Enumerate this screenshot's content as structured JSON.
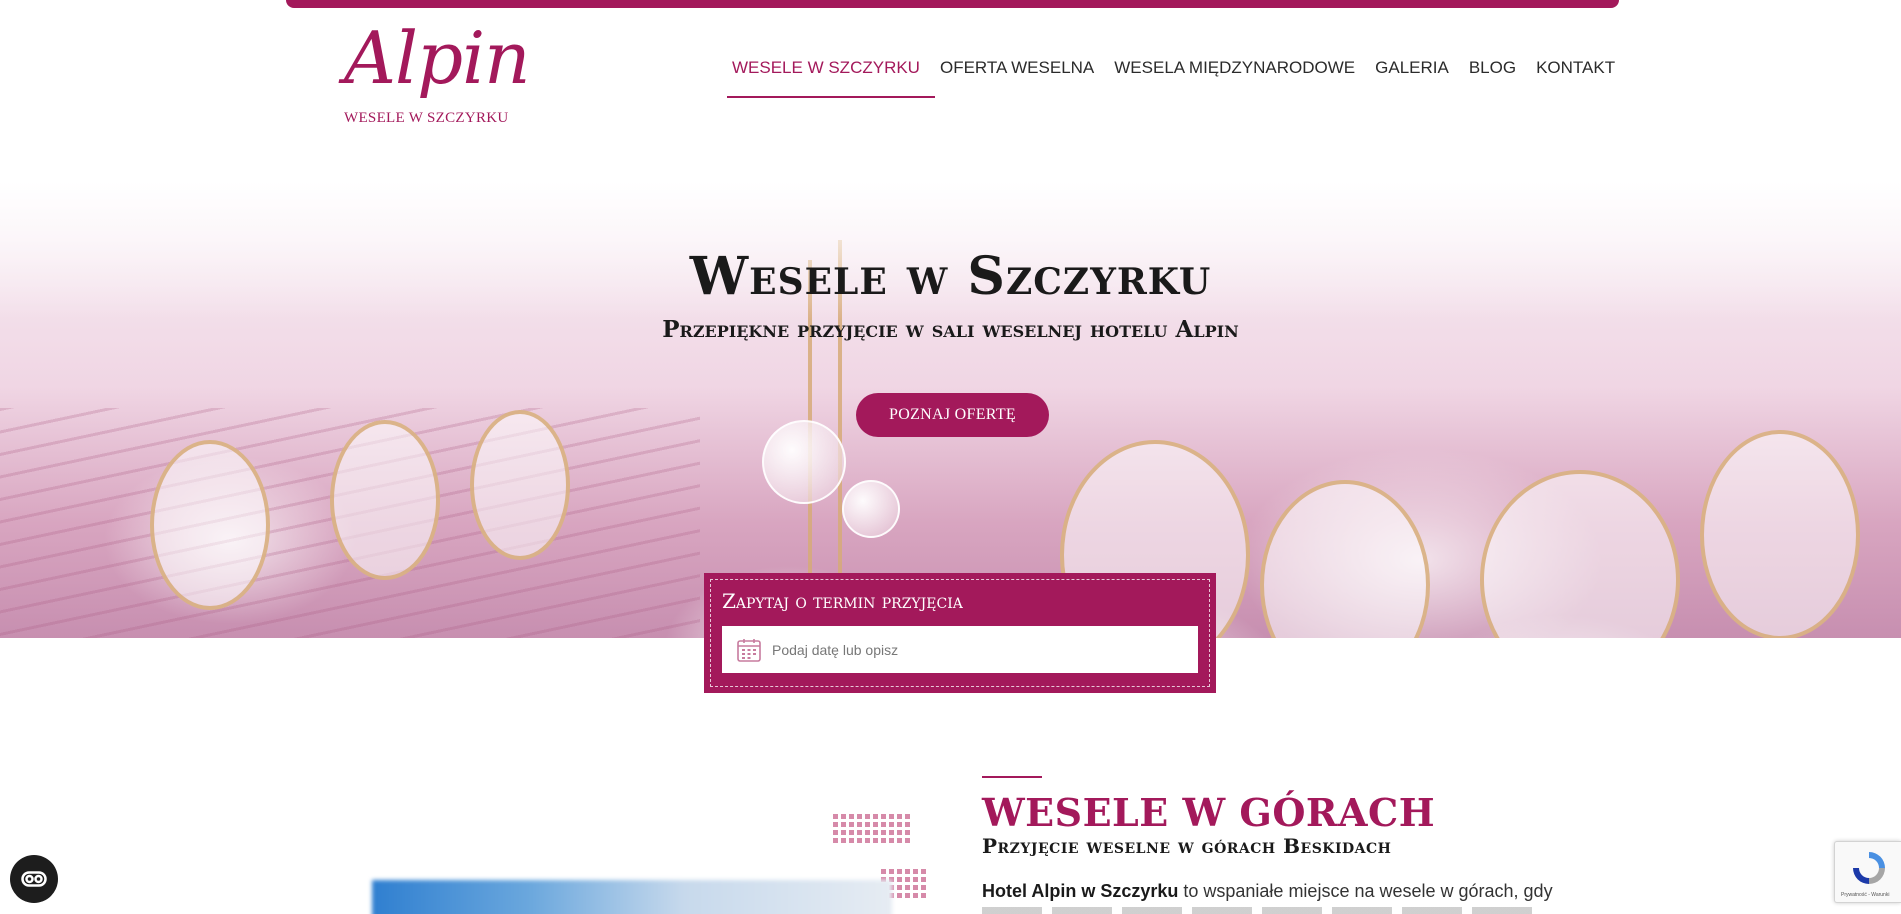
{
  "brand": {
    "logo_script": "Alpin",
    "logo_sub": "WESELE W SZCZYRKU",
    "accent": "#a3195b"
  },
  "nav": {
    "items": [
      {
        "label": "WESELE W SZCZYRKU",
        "active": true
      },
      {
        "label": "OFERTA WESELNA",
        "active": false
      },
      {
        "label": "WESELA MIĘDZYNARODOWE",
        "active": false
      },
      {
        "label": "GALERIA",
        "active": false
      },
      {
        "label": "BLOG",
        "active": false
      },
      {
        "label": "KONTAKT",
        "active": false
      }
    ]
  },
  "hero": {
    "title": "Wesele w Szczyrku",
    "subtitle": "Przepiękne przyjęcie w sali weselnej hotelu Alpin",
    "button_label": "POZNAJ OFERTĘ"
  },
  "inquiry": {
    "title": "Zapytaj o termin przyjęcia",
    "placeholder": "Podaj datę lub opisz",
    "icon": "calendar-icon"
  },
  "section": {
    "title": "WESELE W GÓRACH",
    "subtitle": "Przyjęcie weselne w górach Beskidach",
    "para_bold": "Hotel Alpin w Szczyrku",
    "para_rest": " to wspaniałe miejsce na wesele w górach, gdy"
  },
  "widgets": {
    "accessibility_icon": "accessibility-icon",
    "recaptcha_text": "Prywatność - Warunki"
  }
}
